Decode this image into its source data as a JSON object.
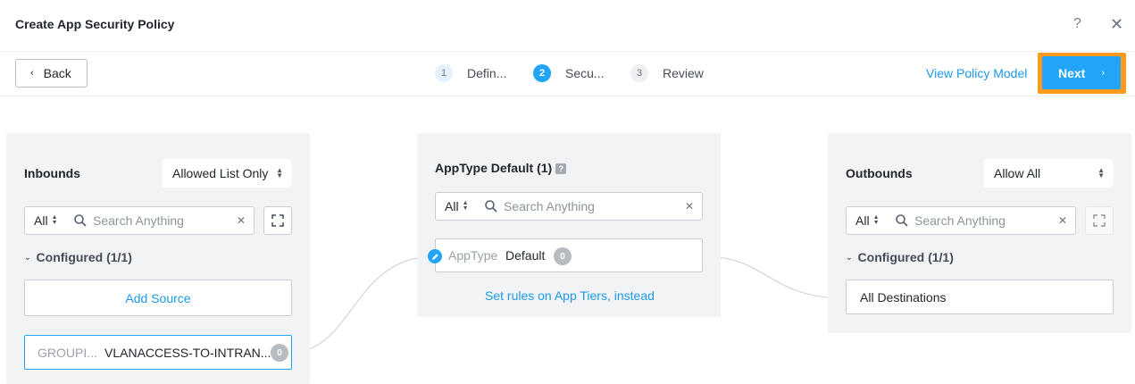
{
  "header": {
    "title": "Create App Security Policy",
    "help_label": "?",
    "close_label": "✕"
  },
  "toolbar": {
    "back_label": "Back",
    "steps": [
      {
        "num": "1",
        "label": "Defin..."
      },
      {
        "num": "2",
        "label": "Secu..."
      },
      {
        "num": "3",
        "label": "Review"
      }
    ],
    "view_policy_label": "View Policy Model",
    "next_label": "Next"
  },
  "inbounds": {
    "title": "Inbounds",
    "mode": "Allowed List Only",
    "filter": "All",
    "search_placeholder": "Search Anything",
    "section_label": "Configured (1/1)",
    "add_source_label": "Add Source",
    "item": {
      "type": "GROUPI...",
      "value": "VLANACCESS-TO-INTRAN...",
      "count": "0"
    }
  },
  "center": {
    "title": "AppType Default (1)",
    "filter": "All",
    "search_placeholder": "Search Anything",
    "item": {
      "type": "AppType",
      "value": "Default",
      "count": "0"
    },
    "rules_link": "Set rules on App Tiers, instead"
  },
  "outbounds": {
    "title": "Outbounds",
    "mode": "Allow All",
    "filter": "All",
    "search_placeholder": "Search Anything",
    "section_label": "Configured (1/1)",
    "item": "All Destinations"
  },
  "colors": {
    "accent": "#22a5f7",
    "link": "#1b9ae8",
    "highlight": "#fb9a1e",
    "panel_bg": "#f2f3f5"
  }
}
